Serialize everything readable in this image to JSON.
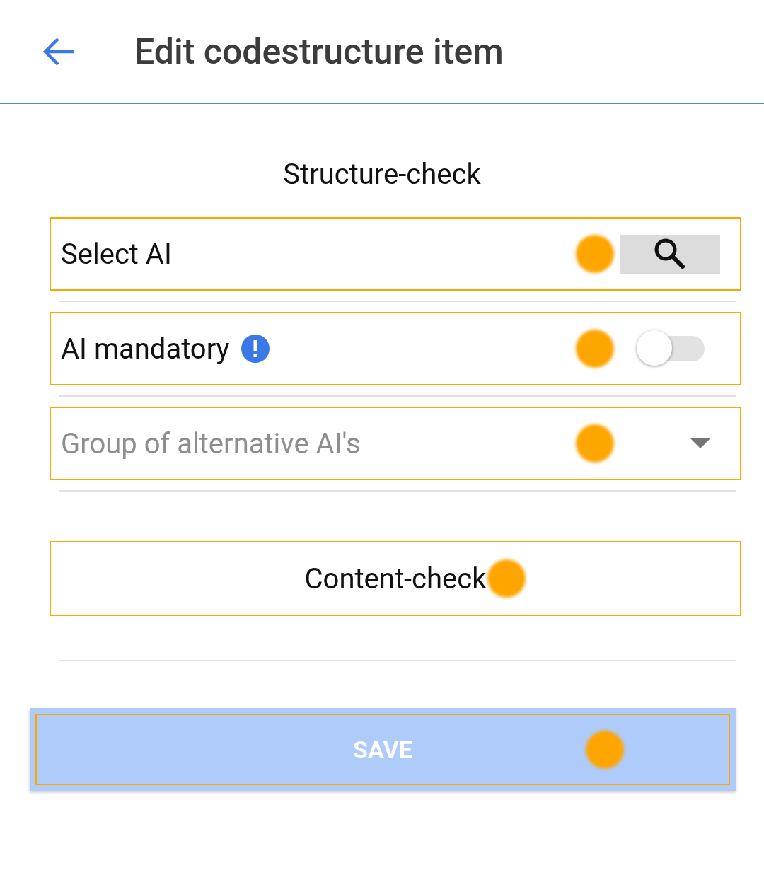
{
  "header": {
    "title": "Edit codestructure item"
  },
  "section_title": "Structure-check",
  "fields": [
    {
      "kind": "search",
      "label": "Select AI",
      "highlighted": true
    },
    {
      "kind": "toggle",
      "label": "AI mandatory",
      "on": false,
      "info": true,
      "highlighted": true
    },
    {
      "kind": "dropdown",
      "placeholder": "Group of alternative AI's",
      "highlighted": true
    }
  ],
  "content_check": {
    "label": "Content-check",
    "highlighted": true
  },
  "save_button": {
    "label": "SAVE",
    "disabled": true,
    "highlighted": true
  }
}
